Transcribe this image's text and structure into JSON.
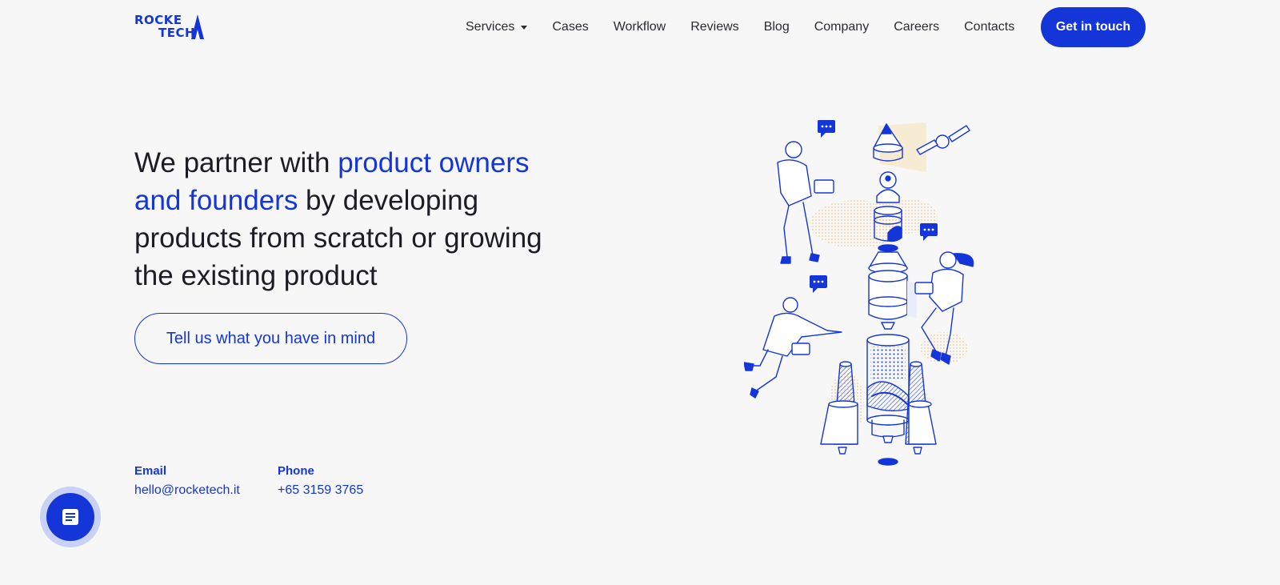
{
  "brand": {
    "logo_line1": "ROCKE",
    "logo_line2": "TECH",
    "color": "#1436d9"
  },
  "nav": {
    "items": [
      {
        "label": "Services",
        "has_dropdown": true
      },
      {
        "label": "Cases"
      },
      {
        "label": "Workflow"
      },
      {
        "label": "Reviews"
      },
      {
        "label": "Blog"
      },
      {
        "label": "Company"
      },
      {
        "label": "Careers"
      },
      {
        "label": "Contacts"
      }
    ],
    "cta_label": "Get in touch"
  },
  "hero": {
    "title_part1": "We partner with ",
    "title_highlight": "product owners and founders",
    "title_part2": " by developing products from scratch or growing the existing product",
    "button_label": "Tell us what you have in mind"
  },
  "contacts": {
    "email_label": "Email",
    "email_value": "hello@rocketech.it",
    "phone_label": "Phone",
    "phone_value": "+65 3159 3765"
  },
  "chat_widget": {
    "icon": "chat-document-icon"
  },
  "illustration": {
    "icon": "rocket-assembly-illustration",
    "colors": {
      "line": "#1436d9",
      "accent": "#f5deb0"
    }
  }
}
